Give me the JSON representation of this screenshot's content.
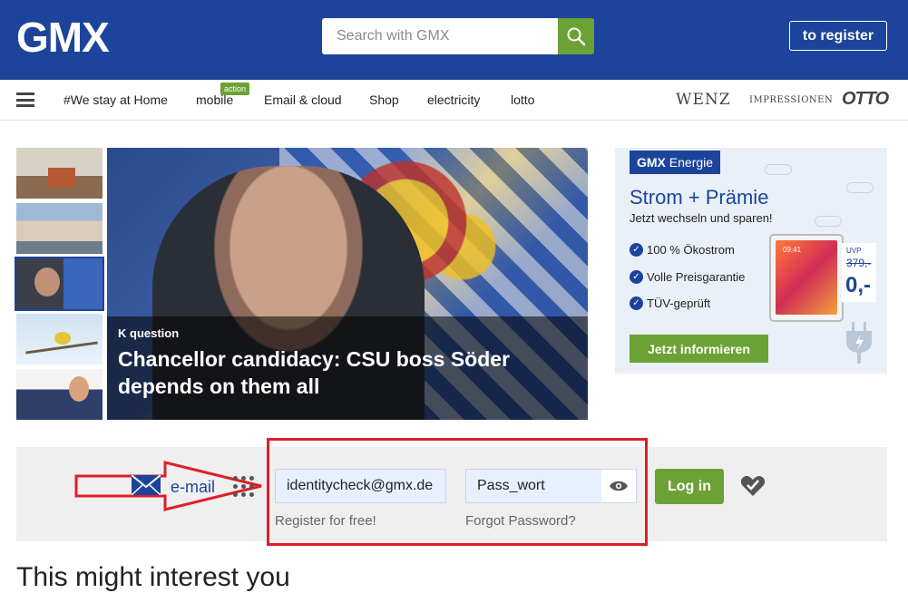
{
  "header": {
    "logo": "GMX",
    "search_placeholder": "Search with GMX",
    "register_label": "to register",
    "colors": {
      "brand_blue": "#1c449b",
      "accent_green": "#6ca235"
    }
  },
  "nav": {
    "items": [
      {
        "label": "#We stay at Home"
      },
      {
        "label": "mobile",
        "badge": "action"
      },
      {
        "label": "Email & cloud"
      },
      {
        "label": "Shop"
      },
      {
        "label": "electricity"
      },
      {
        "label": "lotto"
      }
    ],
    "brands": [
      "WENZ",
      "IMPRESSIONEN",
      "OTTO"
    ]
  },
  "hero": {
    "kicker": "K question",
    "title": "Chancellor candidacy: CSU boss Söder depends on them all"
  },
  "ad": {
    "tag_brand": "GMX",
    "tag_text": "Energie",
    "title": "Strom + Prämie",
    "subtitle": "Jetzt wechseln und sparen!",
    "bullets": [
      "100 % Ökostrom",
      "Volle Preisgarantie",
      "TÜV-geprüft"
    ],
    "tablet_time": "09:41",
    "price_label": "UVP",
    "old_price": "379,-",
    "new_price": "0,-",
    "cta": "Jetzt informieren"
  },
  "login": {
    "service_label": "e-mail",
    "email_value": "identitycheck@gmx.de",
    "password_value": "Pass_wort",
    "register_link": "Register for free!",
    "forgot_link": "Forgot Password?",
    "login_button": "Log in",
    "highlight_color": "#e01d26"
  },
  "section_heading": "This might interest you"
}
